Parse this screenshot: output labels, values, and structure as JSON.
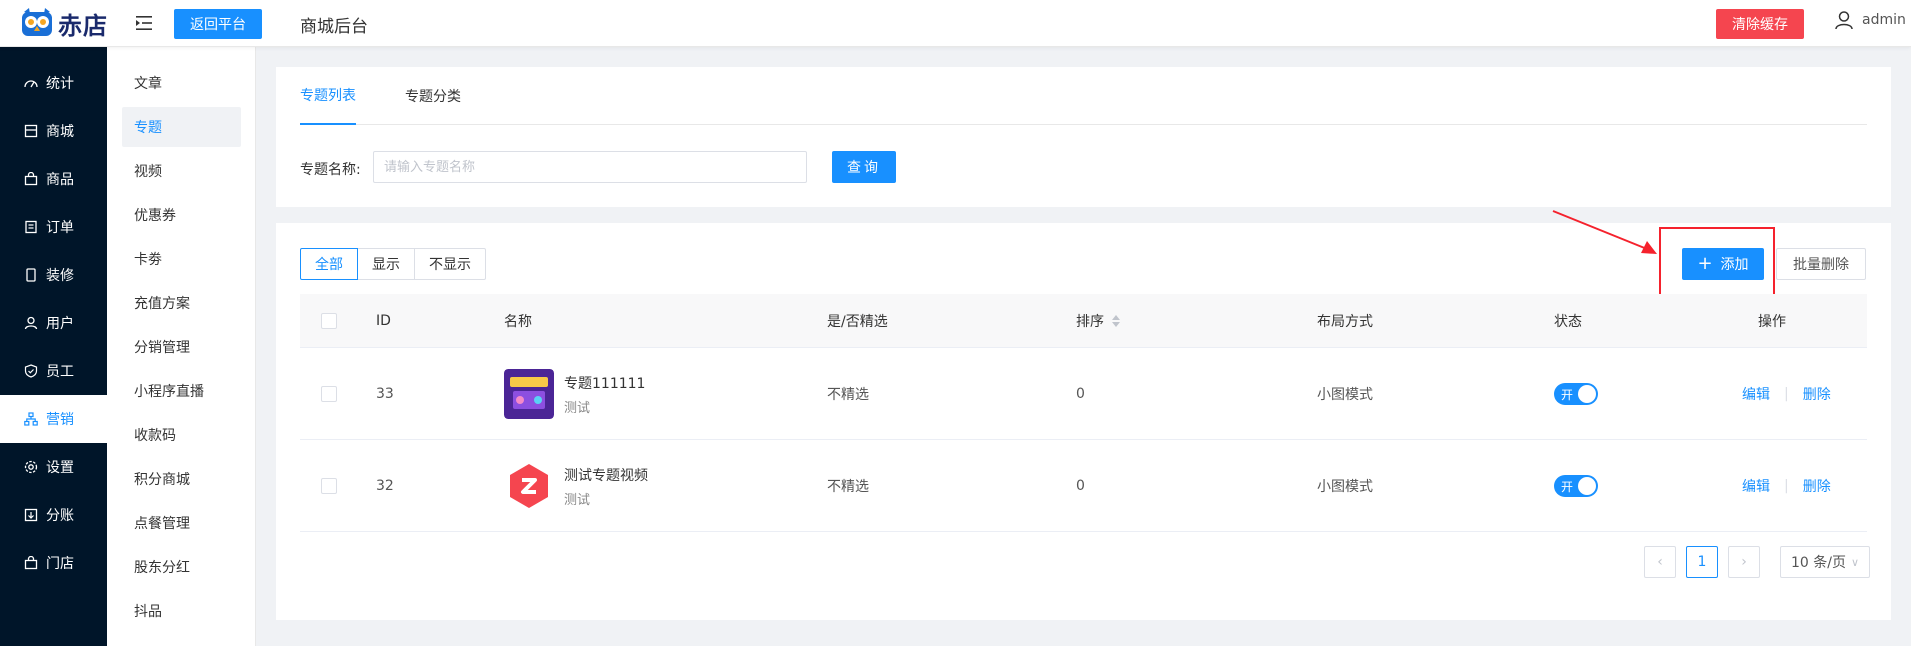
{
  "header": {
    "logo_text": "赤店",
    "back_label": "返回平台",
    "page_heading": "商城后台",
    "clear_cache_label": "清除缓存",
    "user_name": "admin"
  },
  "sidebar_primary": {
    "items": [
      {
        "label": "统计",
        "icon": "dashboard-icon"
      },
      {
        "label": "商城",
        "icon": "store-icon"
      },
      {
        "label": "商品",
        "icon": "bag-icon"
      },
      {
        "label": "订单",
        "icon": "order-icon"
      },
      {
        "label": "装修",
        "icon": "phone-icon"
      },
      {
        "label": "用户",
        "icon": "user-icon"
      },
      {
        "label": "员工",
        "icon": "shield-icon"
      },
      {
        "label": "营销",
        "icon": "sitemap-icon",
        "active": true
      },
      {
        "label": "设置",
        "icon": "gear-icon"
      },
      {
        "label": "分账",
        "icon": "split-icon"
      },
      {
        "label": "门店",
        "icon": "shop-icon"
      }
    ]
  },
  "sidebar_secondary": {
    "items": [
      {
        "label": "文章"
      },
      {
        "label": "专题",
        "active": true
      },
      {
        "label": "视频"
      },
      {
        "label": "优惠券"
      },
      {
        "label": "卡劵"
      },
      {
        "label": "充值方案"
      },
      {
        "label": "分销管理"
      },
      {
        "label": "小程序直播"
      },
      {
        "label": "收款码"
      },
      {
        "label": "积分商城"
      },
      {
        "label": "点餐管理"
      },
      {
        "label": "股东分红"
      },
      {
        "label": "抖品"
      }
    ]
  },
  "tabs": [
    {
      "label": "专题列表",
      "active": true
    },
    {
      "label": "专题分类",
      "active": false
    }
  ],
  "search": {
    "label": "专题名称:",
    "placeholder": "请输入专题名称",
    "value": "",
    "button_label": "查询"
  },
  "filters": [
    {
      "label": "全部",
      "active": true
    },
    {
      "label": "显示",
      "active": false
    },
    {
      "label": "不显示",
      "active": false
    }
  ],
  "actions": {
    "add_label": "添加",
    "batch_delete_label": "批量删除"
  },
  "table": {
    "columns": [
      "ID",
      "名称",
      "是/否精选",
      "排序",
      "布局方式",
      "状态",
      "操作"
    ],
    "rows": [
      {
        "id": "33",
        "title": "专题111111",
        "subtitle": "测试",
        "featured": "不精选",
        "sort": "0",
        "layout": "小图模式",
        "status": "开",
        "edit": "编辑",
        "delete": "删除",
        "thumb_color": "#5a2ea6"
      },
      {
        "id": "32",
        "title": "测试专题视频",
        "subtitle": "测试",
        "featured": "不精选",
        "sort": "0",
        "layout": "小图模式",
        "status": "开",
        "edit": "编辑",
        "delete": "删除",
        "thumb_color": "#f5454f"
      }
    ]
  },
  "pagination": {
    "current_page": "1",
    "page_size_label": "10 条/页"
  },
  "colors": {
    "primary": "#1890ff",
    "danger": "#f5454f",
    "sidebar_bg": "#001529"
  }
}
